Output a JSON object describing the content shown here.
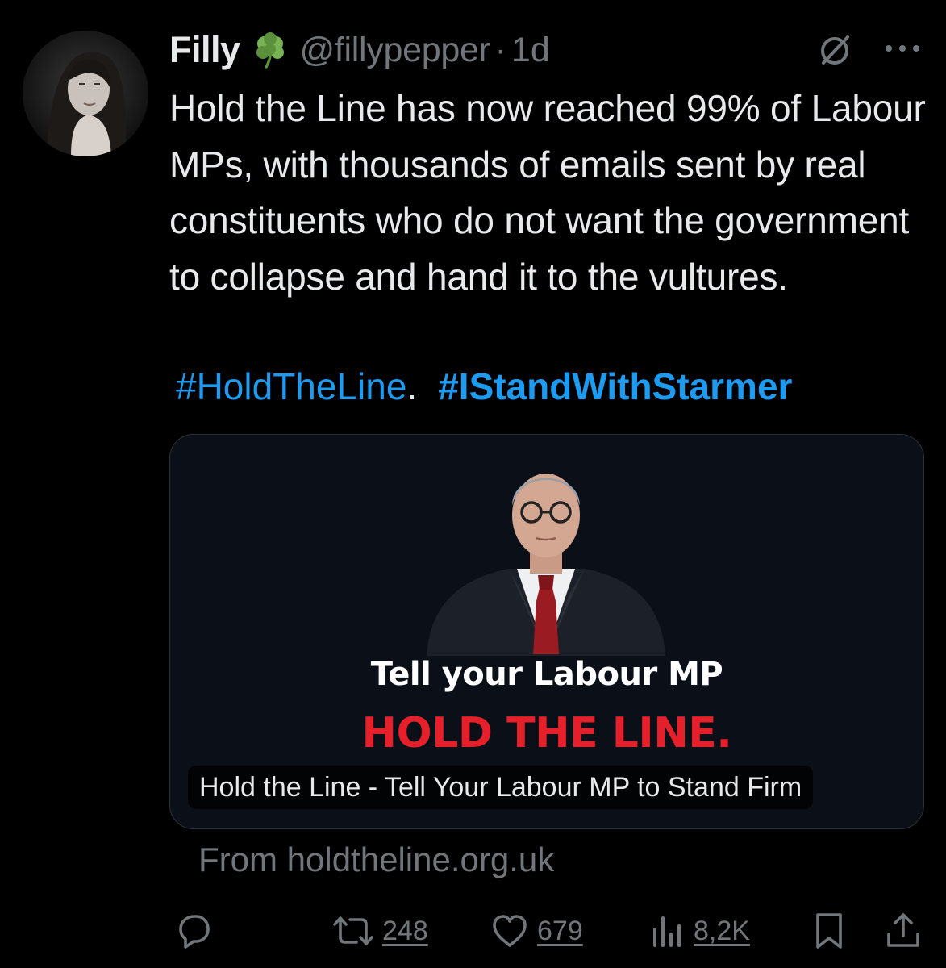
{
  "tweet": {
    "author": {
      "display_name": "Filly",
      "emoji_icon": "shamrock-icon",
      "handle": "@fillypepper",
      "separator": "·",
      "time": "1d"
    },
    "text": "Hold the Line has now reached 99% of Labour MPs, with thousands of emails sent by real constituents who do not want the government to collapse and hand it to the vultures.",
    "hashtags": {
      "first": "#HoldTheLine",
      "first_suffix": ".",
      "second": "#IStandWithStarmer"
    },
    "card": {
      "heading": "Tell your Labour MP",
      "slogan": "HOLD THE LINE.",
      "title": "Hold the Line - Tell Your Labour MP to Stand Firm",
      "source": "From holdtheline.org.uk"
    },
    "actions": {
      "reply_icon": "reply-icon",
      "retweet_icon": "retweet-icon",
      "retweets": "248",
      "like_icon": "heart-icon",
      "likes": "679",
      "views_icon": "views-icon",
      "views": "8,2K",
      "bookmark_icon": "bookmark-icon",
      "share_icon": "share-icon"
    }
  },
  "colors": {
    "background": "#000000",
    "text": "#e7e9ea",
    "secondary": "#71767b",
    "link": "#1d9bf0",
    "slogan_red": "#e5202a",
    "card_bg": "#0b0f17"
  }
}
